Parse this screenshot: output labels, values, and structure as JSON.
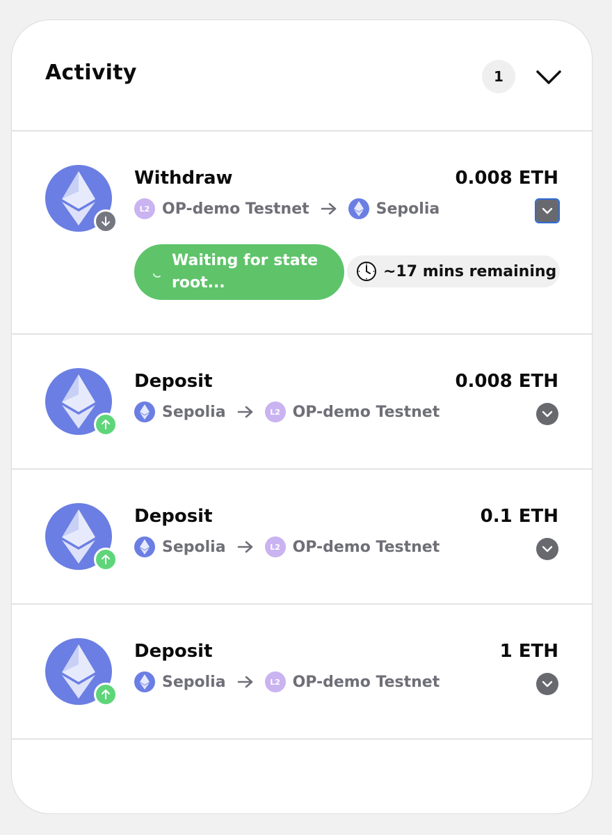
{
  "header": {
    "title": "Activity",
    "pending_count": "1",
    "collapse_icon": "chevron-down-icon"
  },
  "transactions": [
    {
      "title": "Withdraw",
      "amount": "0.008 ETH",
      "direction": "withdraw",
      "from": "OP-demo Testnet",
      "from_icon": "l2-icon",
      "from_icon_text": "L2",
      "to": "Sepolia",
      "to_icon": "ethereum-icon",
      "status": "Waiting for state root...",
      "time_remaining": "~17 mins remaining"
    },
    {
      "title": "Deposit",
      "amount": "0.008 ETH",
      "direction": "deposit",
      "from": "Sepolia",
      "from_icon": "ethereum-icon",
      "to": "OP-demo Testnet",
      "to_icon": "l2-icon",
      "to_icon_text": "L2"
    },
    {
      "title": "Deposit",
      "amount": "0.1 ETH",
      "direction": "deposit",
      "from": "Sepolia",
      "from_icon": "ethereum-icon",
      "to": "OP-demo Testnet",
      "to_icon": "l2-icon",
      "to_icon_text": "L2"
    },
    {
      "title": "Deposit",
      "amount": "1 ETH",
      "direction": "deposit",
      "from": "Sepolia",
      "from_icon": "ethereum-icon",
      "to": "OP-demo Testnet",
      "to_icon": "l2-icon",
      "to_icon_text": "L2"
    }
  ],
  "colors": {
    "ethereum": "#6b7ee3",
    "l2": "#c9b3f0",
    "status_green": "#5fc36a",
    "deposit_badge": "#5fd57a",
    "withdraw_badge": "#747680"
  }
}
